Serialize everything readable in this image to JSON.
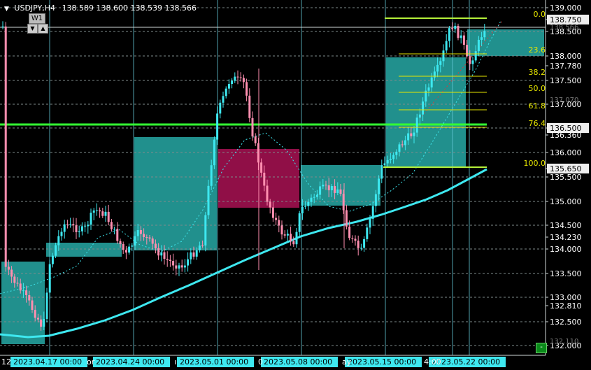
{
  "header": {
    "symbol": "USDJPY,H4",
    "ohlc": "138.589 138.600 138.539 138.566"
  },
  "timeframe": {
    "label": "W1",
    "down_icon": "triangle-down",
    "up_icon": "triangle-up"
  },
  "price_axis": {
    "labels": [
      "139.000",
      "138.750",
      "138.500",
      "138.000",
      "137.780",
      "137.500",
      "137.000",
      "136.500",
      "136.360",
      "136.000",
      "135.650",
      "135.500",
      "135.000",
      "134.500",
      "134.230",
      "134.000",
      "133.500",
      "133.000",
      "132.810",
      "132.500",
      "132.000"
    ],
    "faded_labels": [
      "138.566",
      "137.070",
      "132.110"
    ],
    "highlighted_labels": [
      "138.750",
      "136.500",
      "135.650"
    ]
  },
  "time_axis": {
    "labels": [
      "2023.04.17 00:00",
      "2023.04.24 00:00",
      "2023.05.01 00:00",
      "2023.05.08 00:00",
      "2023.05.15 00:00",
      "2023.05.22 00:00"
    ],
    "fragments": [
      "12",
      "or",
      "ı",
      "0",
      "ay",
      "4:00"
    ]
  },
  "fibonacci": {
    "levels": [
      "0.0",
      "23.6",
      "38.2",
      "50.0",
      "61.8",
      "76.4",
      "100.0"
    ]
  },
  "colors": {
    "background": "#000000",
    "candle_up": "#3ee8f0",
    "candle_down": "#ff8fb0",
    "ma": "#3ee8f0",
    "fib": "#e6e600",
    "horizontal_level": "#33ff33",
    "box_teal": "#27a9a6",
    "box_magenta": "#c0145f",
    "grid": "#7e8a8a",
    "vertical_line": "#64c8d6"
  },
  "buttons": {
    "minimize": "-"
  }
}
